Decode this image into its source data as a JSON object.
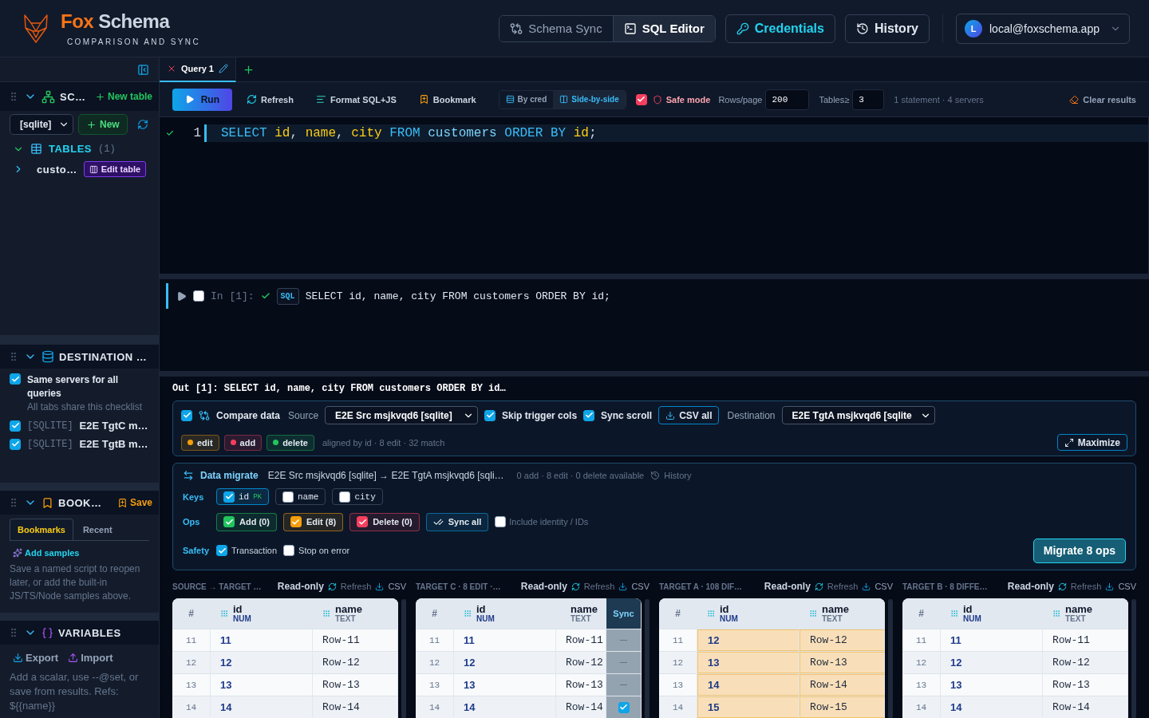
{
  "header": {
    "brand_first": "Fox",
    "brand_second": "Schema",
    "tagline": "COMPARISON AND SYNC",
    "modes": [
      {
        "label": "Schema Sync",
        "selected": false,
        "kind": "sync"
      },
      {
        "label": "SQL Editor",
        "selected": true,
        "kind": "terminal"
      }
    ],
    "credentials": "Credentials",
    "history": "History",
    "account": {
      "initial": "L",
      "email": "local@foxschema.app"
    }
  },
  "sidebar": {
    "schema": {
      "title": "SC…",
      "new_table": "New table",
      "connection": "[sqlite]",
      "new": "New",
      "tree": [
        {
          "label": "TABLES",
          "count": "(1)",
          "expanded": true,
          "children": [
            {
              "label": "custo…",
              "expanded": false,
              "action": "Edit table"
            }
          ]
        }
      ]
    },
    "destination": {
      "title": "DESTINATION …",
      "same_servers": {
        "label": "Same servers for all queries",
        "checked": true,
        "hint": "All tabs share this checklist"
      },
      "servers": [
        {
          "tag": "[SQLITE]",
          "name": "E2E TgtC m…",
          "checked": true
        },
        {
          "tag": "[SQLITE]",
          "name": "E2E TgtB m…",
          "checked": true
        }
      ]
    },
    "bookmarks": {
      "title": "BOOK…",
      "save": "Save",
      "tabs": [
        {
          "label": "Bookmarks",
          "selected": true
        },
        {
          "label": "Recent",
          "selected": false
        }
      ],
      "add_samples": "Add samples",
      "help": "Save a named script to reopen later, or add the built-in JS/TS/Node samples above."
    },
    "variables": {
      "title": "VARIABLES",
      "export": "Export",
      "import": "Import",
      "help": "Add a scalar, use --@set, or save from results. Refs: ${{name}}"
    }
  },
  "editor_tabs": [
    {
      "label": "Query 1",
      "selected": true
    }
  ],
  "toolbar": {
    "run": "Run",
    "refresh": "Refresh",
    "format": "Format SQL+JS",
    "bookmark": "Bookmark",
    "views": [
      {
        "label": "By cred",
        "selected": false,
        "kind": "rows"
      },
      {
        "label": "Side-by-side",
        "selected": true,
        "kind": "columns"
      }
    ],
    "safe_mode": {
      "label": "Safe mode",
      "checked": true
    },
    "rows_per_page": {
      "label": "Rows/page",
      "value": "200"
    },
    "tables_min": {
      "label": "Tables≥",
      "value": "3"
    },
    "summary": "1 statement · 4 servers",
    "clear": "Clear results"
  },
  "editor": {
    "lines": [
      {
        "number": "1",
        "ok": true,
        "tokens": [
          {
            "text": "SELECT ",
            "kind": "keyword"
          },
          {
            "text": "id",
            "kind": "ident"
          },
          {
            "text": ", ",
            "kind": "punct"
          },
          {
            "text": "name",
            "kind": "ident"
          },
          {
            "text": ", ",
            "kind": "punct"
          },
          {
            "text": "city",
            "kind": "ident"
          },
          {
            "text": " FROM ",
            "kind": "keyword"
          },
          {
            "text": "customers",
            "kind": "plain"
          },
          {
            "text": " ORDER BY ",
            "kind": "keyword"
          },
          {
            "text": "id",
            "kind": "ident"
          },
          {
            "text": ";",
            "kind": "punct"
          }
        ]
      }
    ]
  },
  "cell": {
    "checked": false,
    "prompt": "In [1]:",
    "ok": true,
    "lang": "SQL",
    "code": "SELECT id, name, city FROM customers ORDER BY id;"
  },
  "output": {
    "title": "Out [1]: SELECT id, name, city FROM customers ORDER BY id…",
    "compare": {
      "checked": true,
      "label": "Compare data",
      "source_label": "Source",
      "source": "E2E Src msjkvqd6 [sqlite]",
      "skip_trigger": {
        "label": "Skip trigger cols",
        "checked": true
      },
      "sync_scroll": {
        "label": "Sync scroll",
        "checked": true
      },
      "csv_all": "CSV all",
      "destination_label": "Destination",
      "destination": "E2E TgtA msjkvqd6 [sqlite",
      "legend": [
        {
          "label": "edit",
          "color": "#f59e0b"
        },
        {
          "label": "add",
          "color": "#f43f5e"
        },
        {
          "label": "delete",
          "color": "#22c55e"
        }
      ],
      "summary": "aligned by id · 8 edit · 32 match",
      "maximize": "Maximize"
    },
    "migrate": {
      "title": "Data migrate",
      "route": "E2E Src msjkvqd6 [sqlite] → E2E TgtA msjkvqd6 [sqli…",
      "counts": "0 add · 8 edit · 0 delete available",
      "history": "History",
      "keys_label": "Keys",
      "keys": [
        {
          "label": "id",
          "tag": "PK",
          "checked": true
        },
        {
          "label": "name",
          "checked": false
        },
        {
          "label": "city",
          "checked": false
        }
      ],
      "ops_label": "Ops",
      "ops": [
        {
          "label": "Add (0)",
          "checked": true,
          "color": "#22c55e"
        },
        {
          "label": "Edit (8)",
          "checked": true,
          "color": "#f59e0b"
        },
        {
          "label": "Delete (0)",
          "checked": true,
          "color": "#f43f5e"
        }
      ],
      "sync_all": "Sync all",
      "include_identity": {
        "label": "Include identity / IDs",
        "checked": false
      },
      "safety_label": "Safety",
      "transaction": {
        "label": "Transaction",
        "checked": true
      },
      "stop_on_error": {
        "label": "Stop on error",
        "checked": false
      },
      "migrate": "Migrate 8 ops"
    },
    "grids": [
      {
        "title": "SOURCE → TARGET …",
        "mode": "Read-only",
        "refresh": "Refresh",
        "csv": "CSV",
        "index_header": "#",
        "columns": [
          {
            "name": "id",
            "type": "NUM"
          },
          {
            "name": "name",
            "type": "TEXT"
          }
        ],
        "rows": [
          {
            "number": "11",
            "cells": [
              "11",
              "Row-11"
            ],
            "changed": false
          },
          {
            "number": "12",
            "cells": [
              "12",
              "Row-12"
            ],
            "changed": false
          },
          {
            "number": "13",
            "cells": [
              "13",
              "Row-13"
            ],
            "changed": false
          },
          {
            "number": "14",
            "cells": [
              "14",
              "Row-14"
            ],
            "changed": false
          }
        ]
      },
      {
        "title": "TARGET C · 8 EDIT ·…",
        "mode": "Read-only",
        "refresh": "Refresh",
        "csv": "CSV",
        "index_header": "#",
        "sync_header": "Sync",
        "columns": [
          {
            "name": "id",
            "type": "NUM"
          },
          {
            "name": "name",
            "type": "TEXT"
          }
        ],
        "rows": [
          {
            "number": "11",
            "cells": [
              "11",
              "Row-11"
            ],
            "changed": false,
            "sync": {
              "kind": "dash"
            }
          },
          {
            "number": "12",
            "cells": [
              "12",
              "Row-12"
            ],
            "changed": false,
            "sync": {
              "kind": "dash"
            }
          },
          {
            "number": "13",
            "cells": [
              "13",
              "Row-13"
            ],
            "changed": false,
            "sync": {
              "kind": "dash"
            }
          },
          {
            "number": "14",
            "cells": [
              "14",
              "Row-14"
            ],
            "changed": false,
            "sync": {
              "kind": "checkbox",
              "checked": true
            }
          }
        ]
      },
      {
        "title": "TARGET A · 108 DIF…",
        "mode": "Read-only",
        "refresh": "Refresh",
        "csv": "CSV",
        "index_header": "#",
        "columns": [
          {
            "name": "id",
            "type": "NUM"
          },
          {
            "name": "name",
            "type": "TEXT"
          }
        ],
        "rows": [
          {
            "number": "11",
            "cells": [
              "12",
              "Row-12"
            ],
            "changed": true
          },
          {
            "number": "12",
            "cells": [
              "13",
              "Row-13"
            ],
            "changed": true
          },
          {
            "number": "13",
            "cells": [
              "14",
              "Row-14"
            ],
            "changed": true
          },
          {
            "number": "14",
            "cells": [
              "15",
              "Row-15"
            ],
            "changed": true
          }
        ]
      },
      {
        "title": "TARGET B · 8 DIFFE…",
        "mode": "Read-only",
        "refresh": "Refresh",
        "csv": "CSV",
        "index_header": "#",
        "columns": [
          {
            "name": "id",
            "type": "NUM"
          },
          {
            "name": "name",
            "type": "TEXT"
          }
        ],
        "rows": [
          {
            "number": "11",
            "cells": [
              "11",
              "Row-11"
            ],
            "changed": false
          },
          {
            "number": "12",
            "cells": [
              "12",
              "Row-12"
            ],
            "changed": false
          },
          {
            "number": "13",
            "cells": [
              "13",
              "Row-13"
            ],
            "changed": false
          },
          {
            "number": "14",
            "cells": [
              "14",
              "Row-14"
            ],
            "changed": false
          }
        ]
      }
    ]
  }
}
